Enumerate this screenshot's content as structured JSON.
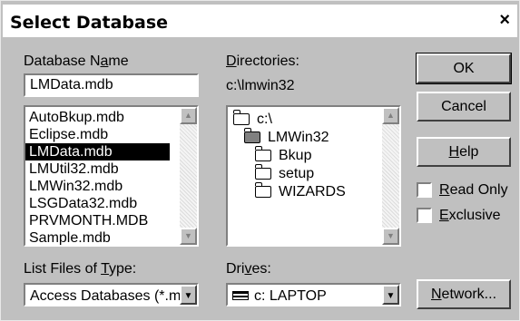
{
  "window": {
    "title": "Select Database",
    "close_glyph": "×"
  },
  "database_name": {
    "label_pre": "Database N",
    "label_ul": "a",
    "label_post": "me",
    "value": "LMData.mdb",
    "files": [
      "AutoBkup.mdb",
      "Eclipse.mdb",
      "LMData.mdb",
      "LMUtil32.mdb",
      "LMWin32.mdb",
      "LSGData32.mdb",
      "PRVMONTH.MDB",
      "Sample.mdb"
    ],
    "selected_file": "LMData.mdb"
  },
  "directories": {
    "label_ul": "D",
    "label_post": "irectories:",
    "current_path": "c:\\lmwin32",
    "tree": [
      {
        "name": "c:\\",
        "state": "open",
        "level": 0
      },
      {
        "name": "LMWin32",
        "state": "open",
        "level": 1
      },
      {
        "name": "Bkup",
        "state": "closed",
        "level": 2
      },
      {
        "name": "setup",
        "state": "closed",
        "level": 2
      },
      {
        "name": "WIZARDS",
        "state": "closed",
        "level": 2
      }
    ]
  },
  "file_type": {
    "label_pre": "List Files of ",
    "label_ul": "T",
    "label_post": "ype:",
    "value": "Access Databases (*.mı"
  },
  "drives": {
    "label_pre": "Dri",
    "label_ul": "v",
    "label_post": "es:",
    "value": "c: LAPTOP"
  },
  "buttons": {
    "ok": "OK",
    "cancel": "Cancel",
    "help_ul": "H",
    "help_post": "elp",
    "network_ul": "N",
    "network_post": "etwork..."
  },
  "checkboxes": {
    "read_only_ul": "R",
    "read_only_post": "ead Only",
    "read_only_checked": false,
    "exclusive_ul": "E",
    "exclusive_post": "xclusive",
    "exclusive_checked": false
  },
  "icons": {
    "scroll_up": "▲",
    "scroll_down": "▼",
    "dropdown": "▼"
  }
}
